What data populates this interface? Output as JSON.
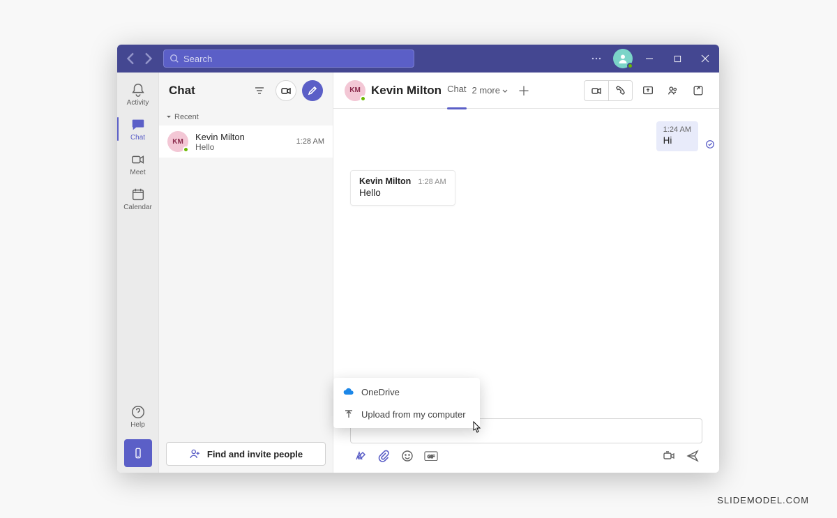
{
  "titlebar": {
    "search_placeholder": "Search"
  },
  "rail": {
    "items": [
      {
        "label": "Activity"
      },
      {
        "label": "Chat"
      },
      {
        "label": "Meet"
      },
      {
        "label": "Calendar"
      }
    ],
    "help_label": "Help"
  },
  "chatlist": {
    "title": "Chat",
    "recent_label": "Recent",
    "items": [
      {
        "initials": "KM",
        "name": "Kevin Milton",
        "preview": "Hello",
        "time": "1:28 AM"
      }
    ],
    "invite_label": "Find and invite people"
  },
  "convo": {
    "avatar_initials": "KM",
    "name": "Kevin Milton",
    "tab_label": "Chat",
    "more_label": "2 more",
    "messages_out": [
      {
        "time": "1:24 AM",
        "text": "Hi"
      }
    ],
    "messages_in": [
      {
        "name": "Kevin Milton",
        "time": "1:28 AM",
        "text": "Hello"
      }
    ]
  },
  "attach_menu": {
    "items": [
      {
        "label": "OneDrive"
      },
      {
        "label": "Upload from my computer"
      }
    ]
  },
  "watermark": "SLIDEMODEL.COM"
}
